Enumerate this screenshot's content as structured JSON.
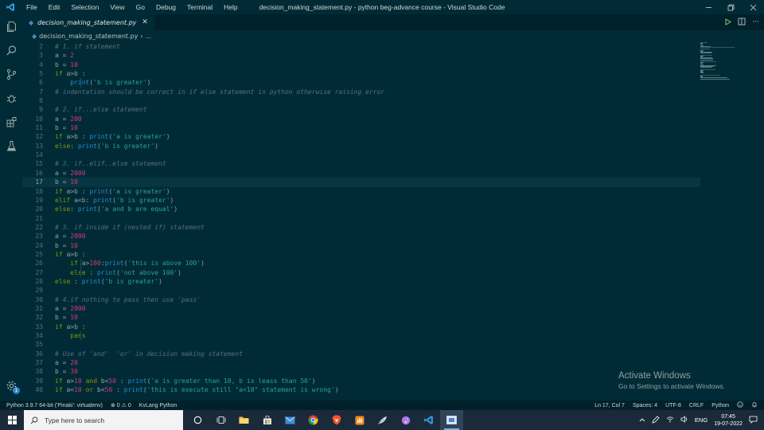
{
  "window": {
    "title": "decision_making_statement.py - python beg-advance course - Visual Studio Code",
    "menu": [
      "File",
      "Edit",
      "Selection",
      "View",
      "Go",
      "Debug",
      "Terminal",
      "Help"
    ]
  },
  "tab": {
    "name": "decision_making_statement.py",
    "close": "✕"
  },
  "breadcrumb": {
    "file": "decision_making_statement.py",
    "separator": "›",
    "more": "..."
  },
  "editor": {
    "current_line": 17,
    "lines": [
      {
        "n": "2",
        "t": [
          [
            "cm",
            "# 1. if statement"
          ]
        ]
      },
      {
        "n": "3",
        "t": [
          [
            "pl",
            "a = "
          ],
          [
            "num",
            "2"
          ]
        ]
      },
      {
        "n": "4",
        "t": [
          [
            "pl",
            "b = "
          ],
          [
            "num",
            "10"
          ]
        ]
      },
      {
        "n": "5",
        "t": [
          [
            "kw",
            "if"
          ],
          [
            "pl",
            " a>b :"
          ]
        ]
      },
      {
        "n": "6",
        "t": [
          [
            "pl",
            "    "
          ],
          [
            "fn",
            "print"
          ],
          [
            "pl",
            "("
          ],
          [
            "str",
            "'b is greater'"
          ],
          [
            "pl",
            ")"
          ]
        ],
        "guide": true
      },
      {
        "n": "7",
        "t": [
          [
            "cm",
            "# indentation should be correct in if else statement in python otherwise raising error"
          ]
        ]
      },
      {
        "n": "8",
        "t": []
      },
      {
        "n": "9",
        "t": [
          [
            "cm",
            "# 2. if...else statement"
          ]
        ]
      },
      {
        "n": "10",
        "t": [
          [
            "pl",
            "a = "
          ],
          [
            "num",
            "200"
          ]
        ]
      },
      {
        "n": "11",
        "t": [
          [
            "pl",
            "b = "
          ],
          [
            "num",
            "10"
          ]
        ]
      },
      {
        "n": "12",
        "t": [
          [
            "kw",
            "if"
          ],
          [
            "pl",
            " a>b : "
          ],
          [
            "fn",
            "print"
          ],
          [
            "pl",
            "("
          ],
          [
            "str",
            "'a is greater'"
          ],
          [
            "pl",
            ")"
          ]
        ]
      },
      {
        "n": "13",
        "t": [
          [
            "kw",
            "else"
          ],
          [
            "pl",
            ": "
          ],
          [
            "fn",
            "print"
          ],
          [
            "pl",
            "("
          ],
          [
            "str",
            "'b is greater'"
          ],
          [
            "pl",
            ")"
          ]
        ]
      },
      {
        "n": "14",
        "t": []
      },
      {
        "n": "15",
        "t": [
          [
            "cm",
            "# 3. if..elif..else statement"
          ]
        ]
      },
      {
        "n": "16",
        "t": [
          [
            "pl",
            "a = "
          ],
          [
            "num",
            "2000"
          ]
        ]
      },
      {
        "n": "17",
        "t": [
          [
            "pl",
            "b = "
          ],
          [
            "num",
            "10"
          ]
        ]
      },
      {
        "n": "18",
        "t": [
          [
            "kw",
            "if"
          ],
          [
            "pl",
            " a>b : "
          ],
          [
            "fn",
            "print"
          ],
          [
            "pl",
            "("
          ],
          [
            "str",
            "'a is greater'"
          ],
          [
            "pl",
            ")"
          ]
        ]
      },
      {
        "n": "19",
        "t": [
          [
            "kw",
            "elif"
          ],
          [
            "pl",
            " a<b: "
          ],
          [
            "fn",
            "print"
          ],
          [
            "pl",
            "("
          ],
          [
            "str",
            "'b is greater'"
          ],
          [
            "pl",
            ")"
          ]
        ]
      },
      {
        "n": "20",
        "t": [
          [
            "kw",
            "else"
          ],
          [
            "pl",
            ": "
          ],
          [
            "fn",
            "print"
          ],
          [
            "pl",
            "("
          ],
          [
            "str",
            "'a and b are equal'"
          ],
          [
            "pl",
            ")"
          ]
        ]
      },
      {
        "n": "21",
        "t": []
      },
      {
        "n": "22",
        "t": [
          [
            "cm",
            "# 3. if inside if (nested if) statement"
          ]
        ]
      },
      {
        "n": "23",
        "t": [
          [
            "pl",
            "a = "
          ],
          [
            "num",
            "2000"
          ]
        ]
      },
      {
        "n": "24",
        "t": [
          [
            "pl",
            "b = "
          ],
          [
            "num",
            "10"
          ]
        ]
      },
      {
        "n": "25",
        "t": [
          [
            "kw",
            "if"
          ],
          [
            "pl",
            " a>b :"
          ]
        ]
      },
      {
        "n": "26",
        "t": [
          [
            "pl",
            "    "
          ],
          [
            "kw",
            "if"
          ],
          [
            "pl",
            " a>"
          ],
          [
            "num",
            "100"
          ],
          [
            "pl",
            ":"
          ],
          [
            "fn",
            "print"
          ],
          [
            "pl",
            "("
          ],
          [
            "str",
            "'this is above 100'"
          ],
          [
            "pl",
            ")"
          ]
        ],
        "guide": true
      },
      {
        "n": "27",
        "t": [
          [
            "pl",
            "    "
          ],
          [
            "kw",
            "else"
          ],
          [
            "pl",
            " : "
          ],
          [
            "fn",
            "print"
          ],
          [
            "pl",
            "("
          ],
          [
            "str",
            "'not above 100'"
          ],
          [
            "pl",
            ")"
          ]
        ],
        "guide": true
      },
      {
        "n": "28",
        "t": [
          [
            "kw",
            "else"
          ],
          [
            "pl",
            " : "
          ],
          [
            "fn",
            "print"
          ],
          [
            "pl",
            "("
          ],
          [
            "str",
            "'b is greater'"
          ],
          [
            "pl",
            ")"
          ]
        ]
      },
      {
        "n": "29",
        "t": []
      },
      {
        "n": "30",
        "t": [
          [
            "cm",
            "# 4.if nothing to pass then use 'pass'"
          ]
        ]
      },
      {
        "n": "31",
        "t": [
          [
            "pl",
            "a = "
          ],
          [
            "num",
            "2000"
          ]
        ]
      },
      {
        "n": "32",
        "t": [
          [
            "pl",
            "b = "
          ],
          [
            "num",
            "10"
          ]
        ]
      },
      {
        "n": "33",
        "t": [
          [
            "kw",
            "if"
          ],
          [
            "pl",
            " a>b :"
          ]
        ]
      },
      {
        "n": "34",
        "t": [
          [
            "pl",
            "    "
          ],
          [
            "kw",
            "pass"
          ]
        ],
        "guide": true
      },
      {
        "n": "35",
        "t": []
      },
      {
        "n": "36",
        "t": [
          [
            "cm",
            "# Use of 'and'  'or' in decision making statement"
          ]
        ]
      },
      {
        "n": "37",
        "t": [
          [
            "pl",
            "a = "
          ],
          [
            "num",
            "20"
          ]
        ]
      },
      {
        "n": "38",
        "t": [
          [
            "pl",
            "b = "
          ],
          [
            "num",
            "30"
          ]
        ]
      },
      {
        "n": "39",
        "t": [
          [
            "kw",
            "if"
          ],
          [
            "pl",
            " a>"
          ],
          [
            "num",
            "10"
          ],
          [
            "pl",
            " "
          ],
          [
            "kw",
            "and"
          ],
          [
            "pl",
            " b<"
          ],
          [
            "num",
            "50"
          ],
          [
            "pl",
            " : "
          ],
          [
            "fn",
            "print"
          ],
          [
            "pl",
            "("
          ],
          [
            "str",
            "'a is greater than 10, b is leass than 50'"
          ],
          [
            "pl",
            ")"
          ]
        ]
      },
      {
        "n": "40",
        "t": [
          [
            "kw",
            "if"
          ],
          [
            "pl",
            " a<"
          ],
          [
            "num",
            "10"
          ],
          [
            "pl",
            " "
          ],
          [
            "kw",
            "or"
          ],
          [
            "pl",
            " b<"
          ],
          [
            "num",
            "50"
          ],
          [
            "pl",
            " : "
          ],
          [
            "fn",
            "print"
          ],
          [
            "pl",
            "("
          ],
          [
            "str",
            "'this is execute still \"a<10\" statement is wrong'"
          ],
          [
            "pl",
            ")"
          ]
        ]
      }
    ]
  },
  "activation": {
    "title": "Activate Windows",
    "subtitle": "Go to Settings to activate Windows."
  },
  "status": {
    "interpreter": "Python 3.9.7 64-bit ('Pinaki': virtualenv)",
    "errors": "0",
    "warnings": "0",
    "kivy": "KvLang Python",
    "position": "Ln 17, Col 7",
    "spaces": "Spaces: 4",
    "encoding": "UTF-8",
    "eol": "CRLF",
    "language": "Python"
  },
  "taskbar": {
    "search_placeholder": "Type here to search",
    "lang": "ENG",
    "time": "07:45",
    "date": "19-07-2022"
  },
  "notifications_badge": "1",
  "colors": {
    "background": "#002b36",
    "keyword": "#859900",
    "number": "#d33682",
    "string": "#2aa198",
    "function": "#268bd2",
    "comment": "#586e75"
  }
}
